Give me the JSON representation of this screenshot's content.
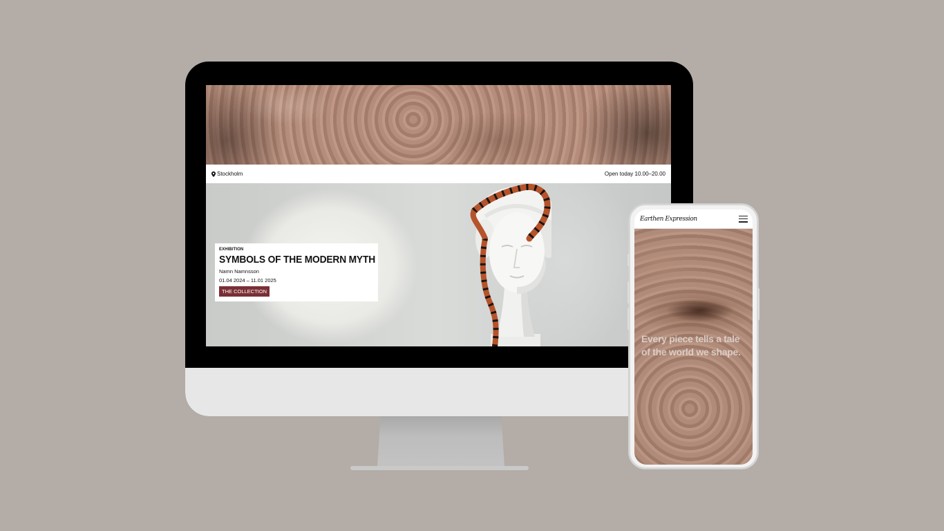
{
  "desktop": {
    "infobar": {
      "location": "Stockholm",
      "hours": "Open today 10.00–20.00"
    },
    "exhibition": {
      "kicker": "EXHIBITION",
      "title": "SYMBOLS OF THE MODERN MYTH",
      "artist": "Namn Namnsson",
      "dates": "01.04 2024 – 11.01 2025",
      "button_label": "THE COLLECTION"
    }
  },
  "mobile": {
    "logo": "Earthen Expression",
    "tagline": "Every piece tells a tale of the world we shape."
  },
  "colors": {
    "background": "#b4aca7",
    "accent": "#7a2f34",
    "clay": "#a87e6c"
  },
  "icons": [
    "location-pin-icon",
    "hamburger-menu-icon"
  ]
}
